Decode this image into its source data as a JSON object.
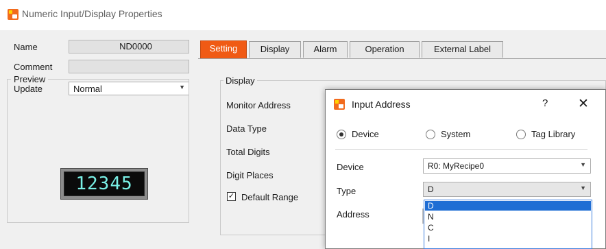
{
  "window": {
    "title": "Numeric Input/Display Properties"
  },
  "left": {
    "name_label": "Name",
    "name_value": "ND0000",
    "comment_label": "Comment",
    "comment_value": "",
    "update_label": "Update",
    "update_value": "Normal",
    "preview_label": "Preview",
    "preview_digits": "12345",
    "preview_digit_color": "#79f0e6"
  },
  "tabs": [
    {
      "label": "Setting",
      "active": true
    },
    {
      "label": "Display",
      "active": false
    },
    {
      "label": "Alarm",
      "active": false
    },
    {
      "label": "Operation",
      "active": false
    },
    {
      "label": "External Label",
      "active": false
    }
  ],
  "display_group": {
    "title": "Display",
    "monitor_address": "Monitor Address",
    "data_type": "Data Type",
    "total_digits": "Total Digits",
    "digit_places": "Digit Places",
    "default_range": "Default Range",
    "default_range_checked": true
  },
  "dialog": {
    "title": "Input Address",
    "help": "?",
    "close": "✕",
    "radios": [
      {
        "label": "Device",
        "selected": true
      },
      {
        "label": "System",
        "selected": false
      },
      {
        "label": "Tag Library",
        "selected": false
      }
    ],
    "device_label": "Device",
    "device_value": "R0: MyRecipe0",
    "type_label": "Type",
    "type_value": "D",
    "address_label": "Address",
    "type_options": [
      "D",
      "N",
      "C",
      "I"
    ],
    "type_selected_index": 0
  },
  "colors": {
    "accent": "#f05a14",
    "selection": "#1f6ed4"
  }
}
